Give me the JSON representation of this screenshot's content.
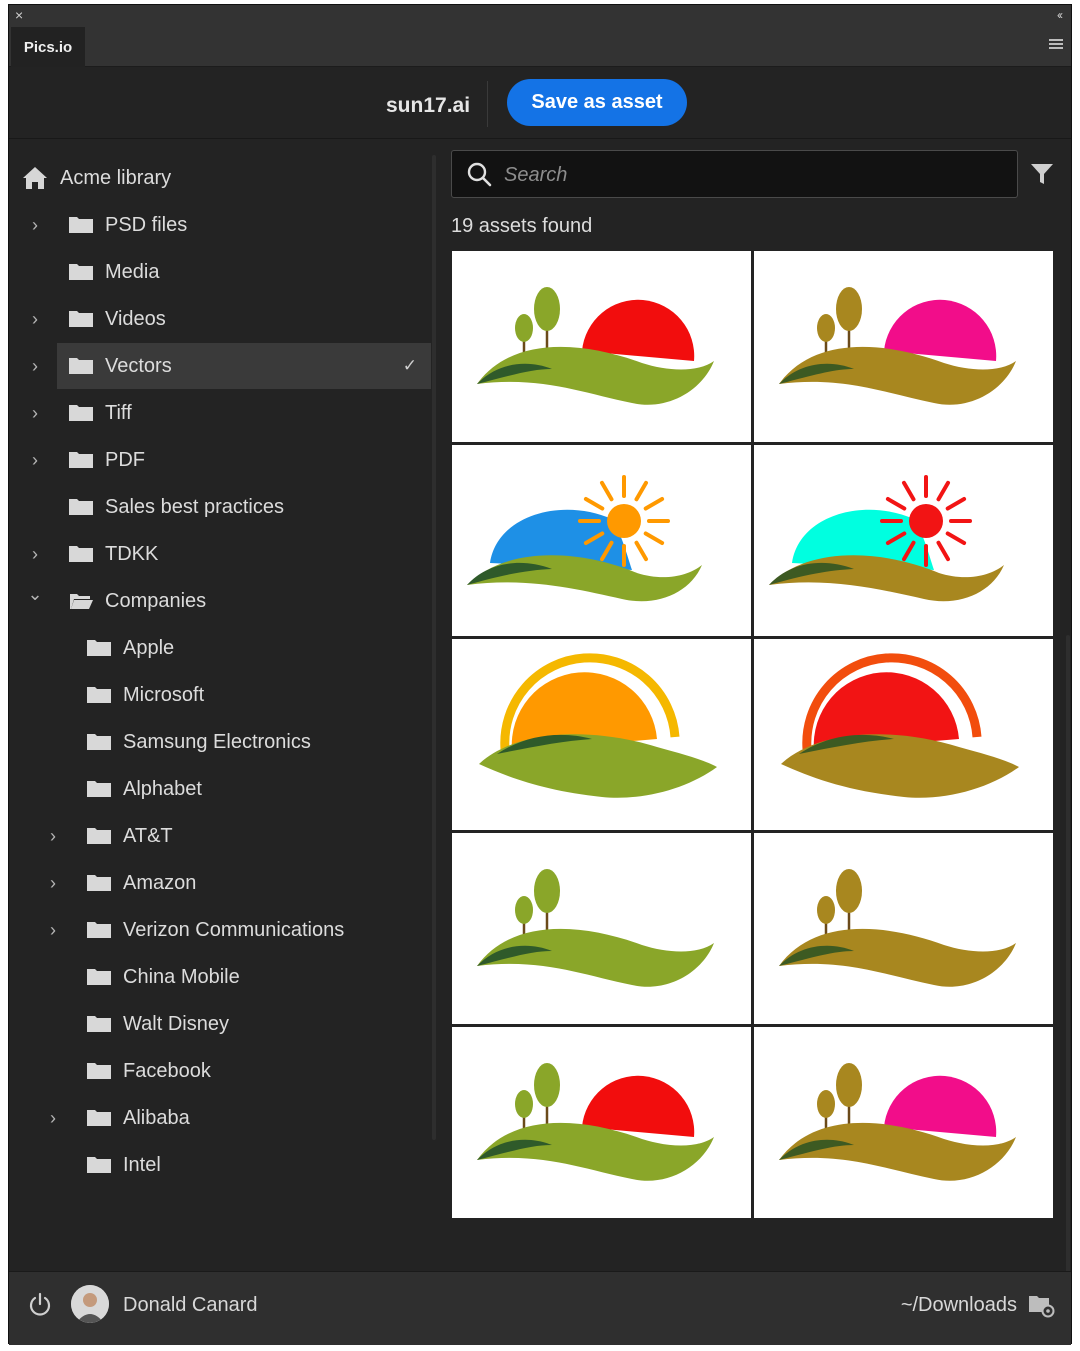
{
  "panel": {
    "tab_label": "Pics.io",
    "close_glyph": "×",
    "collapse_glyph": "‹‹"
  },
  "header": {
    "filename": "sun17.ai",
    "save_label": "Save as asset"
  },
  "library": {
    "root_label": "Acme library"
  },
  "tree": [
    {
      "label": "PSD files",
      "expandable": true,
      "expanded": false,
      "level": 0
    },
    {
      "label": "Media",
      "expandable": false,
      "level": 0
    },
    {
      "label": "Videos",
      "expandable": true,
      "expanded": false,
      "level": 0
    },
    {
      "label": "Vectors",
      "expandable": true,
      "expanded": false,
      "level": 0,
      "selected": true
    },
    {
      "label": "Tiff",
      "expandable": true,
      "expanded": false,
      "level": 0
    },
    {
      "label": "PDF",
      "expandable": true,
      "expanded": false,
      "level": 0
    },
    {
      "label": "Sales best practices",
      "expandable": false,
      "level": 0
    },
    {
      "label": "TDKK",
      "expandable": true,
      "expanded": false,
      "level": 0
    },
    {
      "label": "Companies",
      "expandable": true,
      "expanded": true,
      "level": 0
    },
    {
      "label": "Apple",
      "expandable": false,
      "level": 1
    },
    {
      "label": "Microsoft",
      "expandable": false,
      "level": 1
    },
    {
      "label": "Samsung Electronics",
      "expandable": false,
      "level": 1
    },
    {
      "label": "Alphabet",
      "expandable": false,
      "level": 1
    },
    {
      "label": "AT&T",
      "expandable": true,
      "expanded": false,
      "level": 1
    },
    {
      "label": "Amazon",
      "expandable": true,
      "expanded": false,
      "level": 1
    },
    {
      "label": "Verizon Communications",
      "expandable": true,
      "expanded": false,
      "level": 1
    },
    {
      "label": "China Mobile",
      "expandable": false,
      "level": 1
    },
    {
      "label": "Walt Disney",
      "expandable": false,
      "level": 1
    },
    {
      "label": "Facebook",
      "expandable": false,
      "level": 1
    },
    {
      "label": "Alibaba",
      "expandable": true,
      "expanded": false,
      "level": 1
    },
    {
      "label": "Intel",
      "expandable": false,
      "level": 1
    }
  ],
  "search": {
    "placeholder": "Search",
    "value": ""
  },
  "results": {
    "count_text": "19 assets found"
  },
  "assets": [
    {
      "kind": "trees-sun",
      "sun": "#f20d0d",
      "hill": "#8aa629",
      "dark": "#2f5a2a",
      "tree": "#8aa629"
    },
    {
      "kind": "trees-sun",
      "sun": "#f20d8a",
      "hill": "#a8871f",
      "dark": "#3d5a22",
      "tree": "#a8871f"
    },
    {
      "kind": "rays",
      "sky": "#1e90e6",
      "sun": "#ff9900",
      "hill": "#8aa629",
      "dark": "#2f5a2a"
    },
    {
      "kind": "rays",
      "sky": "#00ffe0",
      "sun": "#f21414",
      "hill": "#a8871f",
      "dark": "#3d5a22"
    },
    {
      "kind": "ring",
      "ring": "#f5b800",
      "sun": "#ff9900",
      "hill": "#8aa629",
      "dark": "#2f5a2a"
    },
    {
      "kind": "ring",
      "ring": "#f24d0d",
      "sun": "#f21414",
      "hill": "#a8871f",
      "dark": "#3d5a22"
    },
    {
      "kind": "trees",
      "hill": "#8aa629",
      "dark": "#2f5a2a",
      "tree": "#8aa629"
    },
    {
      "kind": "trees",
      "hill": "#a8871f",
      "dark": "#3d5a22",
      "tree": "#a8871f"
    },
    {
      "kind": "trees-sun",
      "sun": "#f20d0d",
      "hill": "#8aa629",
      "dark": "#2f5a2a",
      "tree": "#8aa629"
    },
    {
      "kind": "trees-sun",
      "sun": "#f20d8a",
      "hill": "#a8871f",
      "dark": "#3d5a22",
      "tree": "#a8871f"
    }
  ],
  "footer": {
    "username": "Donald Canard",
    "download_path": "~/Downloads"
  },
  "icons": {
    "home": "home-icon",
    "folder": "folder-icon",
    "chevron": "chevron-right-icon",
    "check": "checkmark-icon",
    "search": "search-icon",
    "filter": "filter-icon",
    "power": "power-icon",
    "download_settings": "folder-settings-icon"
  },
  "colors": {
    "accent": "#1473e6",
    "panel_bg": "#232323",
    "selected_bg": "#3a3a3a"
  }
}
